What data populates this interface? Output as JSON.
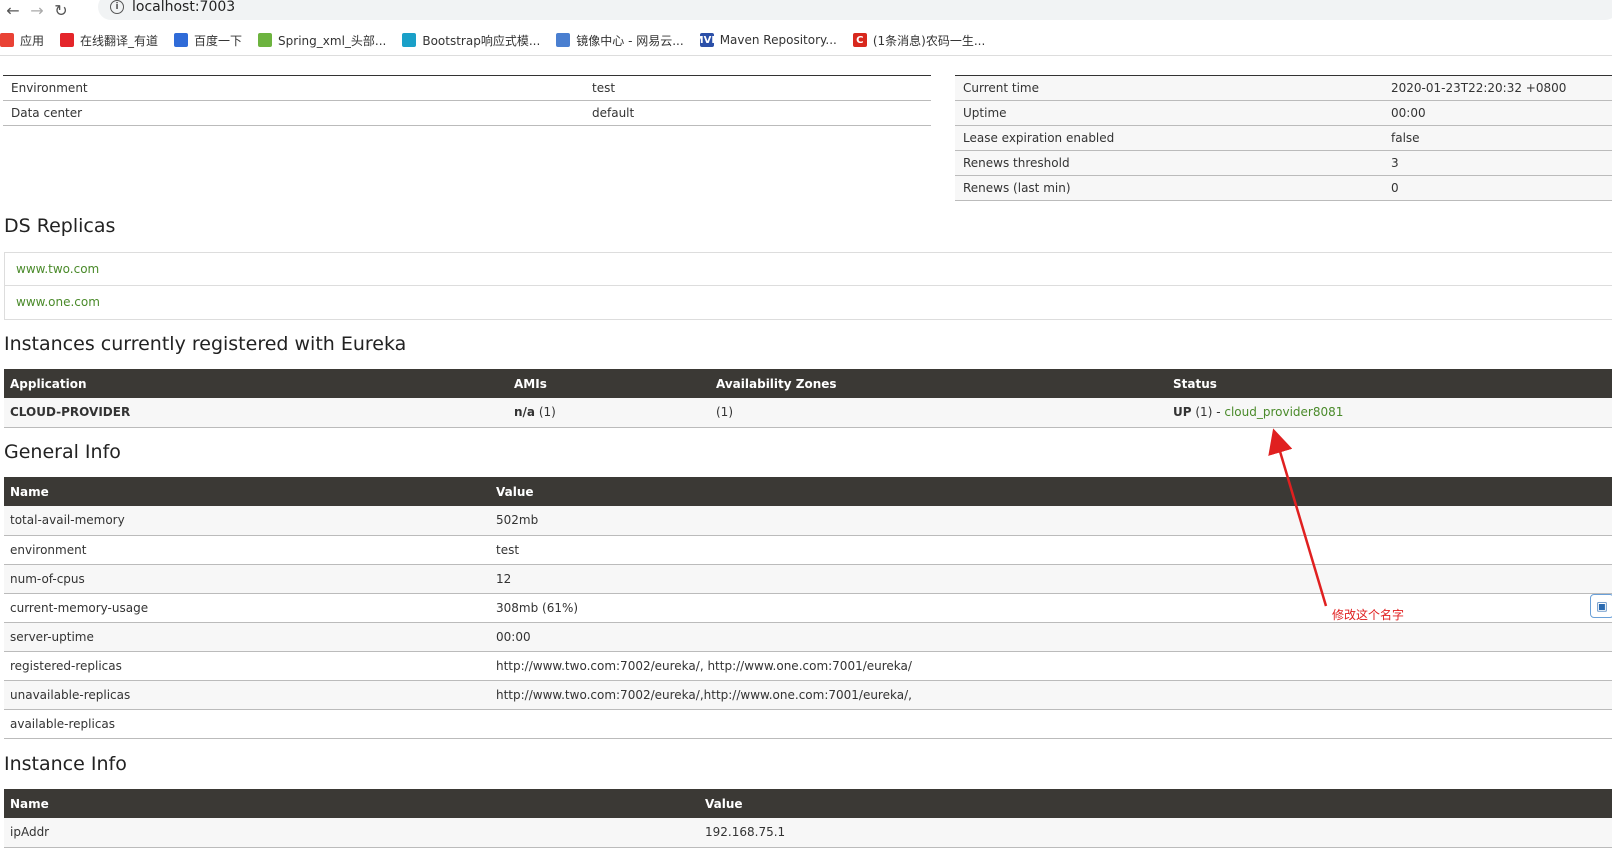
{
  "browser": {
    "url": "localhost:7003",
    "bookmarks": [
      {
        "label": "应用",
        "icon": "apps-grid-icon",
        "color": "#e94235"
      },
      {
        "label": "在线翻译_有道",
        "icon": "youdao-icon",
        "color": "#e4252a"
      },
      {
        "label": "百度一下",
        "icon": "baidu-paw-icon",
        "color": "#2f6bd8"
      },
      {
        "label": "Spring_xml_头部...",
        "icon": "spring-leaf-icon",
        "color": "#6db33f"
      },
      {
        "label": "Bootstrap响应式模...",
        "icon": "cube-icon",
        "color": "#1aa0c8"
      },
      {
        "label": "镜像中心 - 网易云...",
        "icon": "cloud-icon",
        "color": "#4a7fd0"
      },
      {
        "label": "Maven Repository...",
        "icon": "mvn-icon",
        "color": "#2b4fa8",
        "text": "MVN"
      },
      {
        "label": "(1条消息)农码一生...",
        "icon": "csdn-icon",
        "color": "#d8281d",
        "text": "C"
      }
    ]
  },
  "system_status": {
    "left": [
      {
        "name": "Environment",
        "value": "test"
      },
      {
        "name": "Data center",
        "value": "default"
      }
    ],
    "right": [
      {
        "name": "Current time",
        "value": "2020-01-23T22:20:32 +0800"
      },
      {
        "name": "Uptime",
        "value": "00:00"
      },
      {
        "name": "Lease expiration enabled",
        "value": "false"
      },
      {
        "name": "Renews threshold",
        "value": "3"
      },
      {
        "name": "Renews (last min)",
        "value": "0"
      }
    ]
  },
  "ds_replicas": {
    "title": "DS Replicas",
    "items": [
      "www.two.com",
      "www.one.com"
    ]
  },
  "instances": {
    "title": "Instances currently registered with Eureka",
    "headers": [
      "Application",
      "AMIs",
      "Availability Zones",
      "Status"
    ],
    "rows": [
      {
        "application": "CLOUD-PROVIDER",
        "amis_bold": "n/a",
        "amis_count": "(1)",
        "zones": "(1)",
        "status_bold": "UP",
        "status_count": "(1) -",
        "status_link": "cloud_provider8081"
      }
    ]
  },
  "general_info": {
    "title": "General Info",
    "headers": [
      "Name",
      "Value"
    ],
    "rows": [
      {
        "name": "total-avail-memory",
        "value": "502mb"
      },
      {
        "name": "environment",
        "value": "test"
      },
      {
        "name": "num-of-cpus",
        "value": "12"
      },
      {
        "name": "current-memory-usage",
        "value": "308mb (61%)"
      },
      {
        "name": "server-uptime",
        "value": "00:00"
      },
      {
        "name": "registered-replicas",
        "value": "http://www.two.com:7002/eureka/, http://www.one.com:7001/eureka/"
      },
      {
        "name": "unavailable-replicas",
        "value": "http://www.two.com:7002/eureka/,http://www.one.com:7001/eureka/,"
      },
      {
        "name": "available-replicas",
        "value": ""
      }
    ]
  },
  "instance_info": {
    "title": "Instance Info",
    "headers": [
      "Name",
      "Value"
    ],
    "rows": [
      {
        "name": "ipAddr",
        "value": "192.168.75.1"
      }
    ]
  },
  "annotation": {
    "text": "修改这个名字",
    "color": "#e02020"
  }
}
